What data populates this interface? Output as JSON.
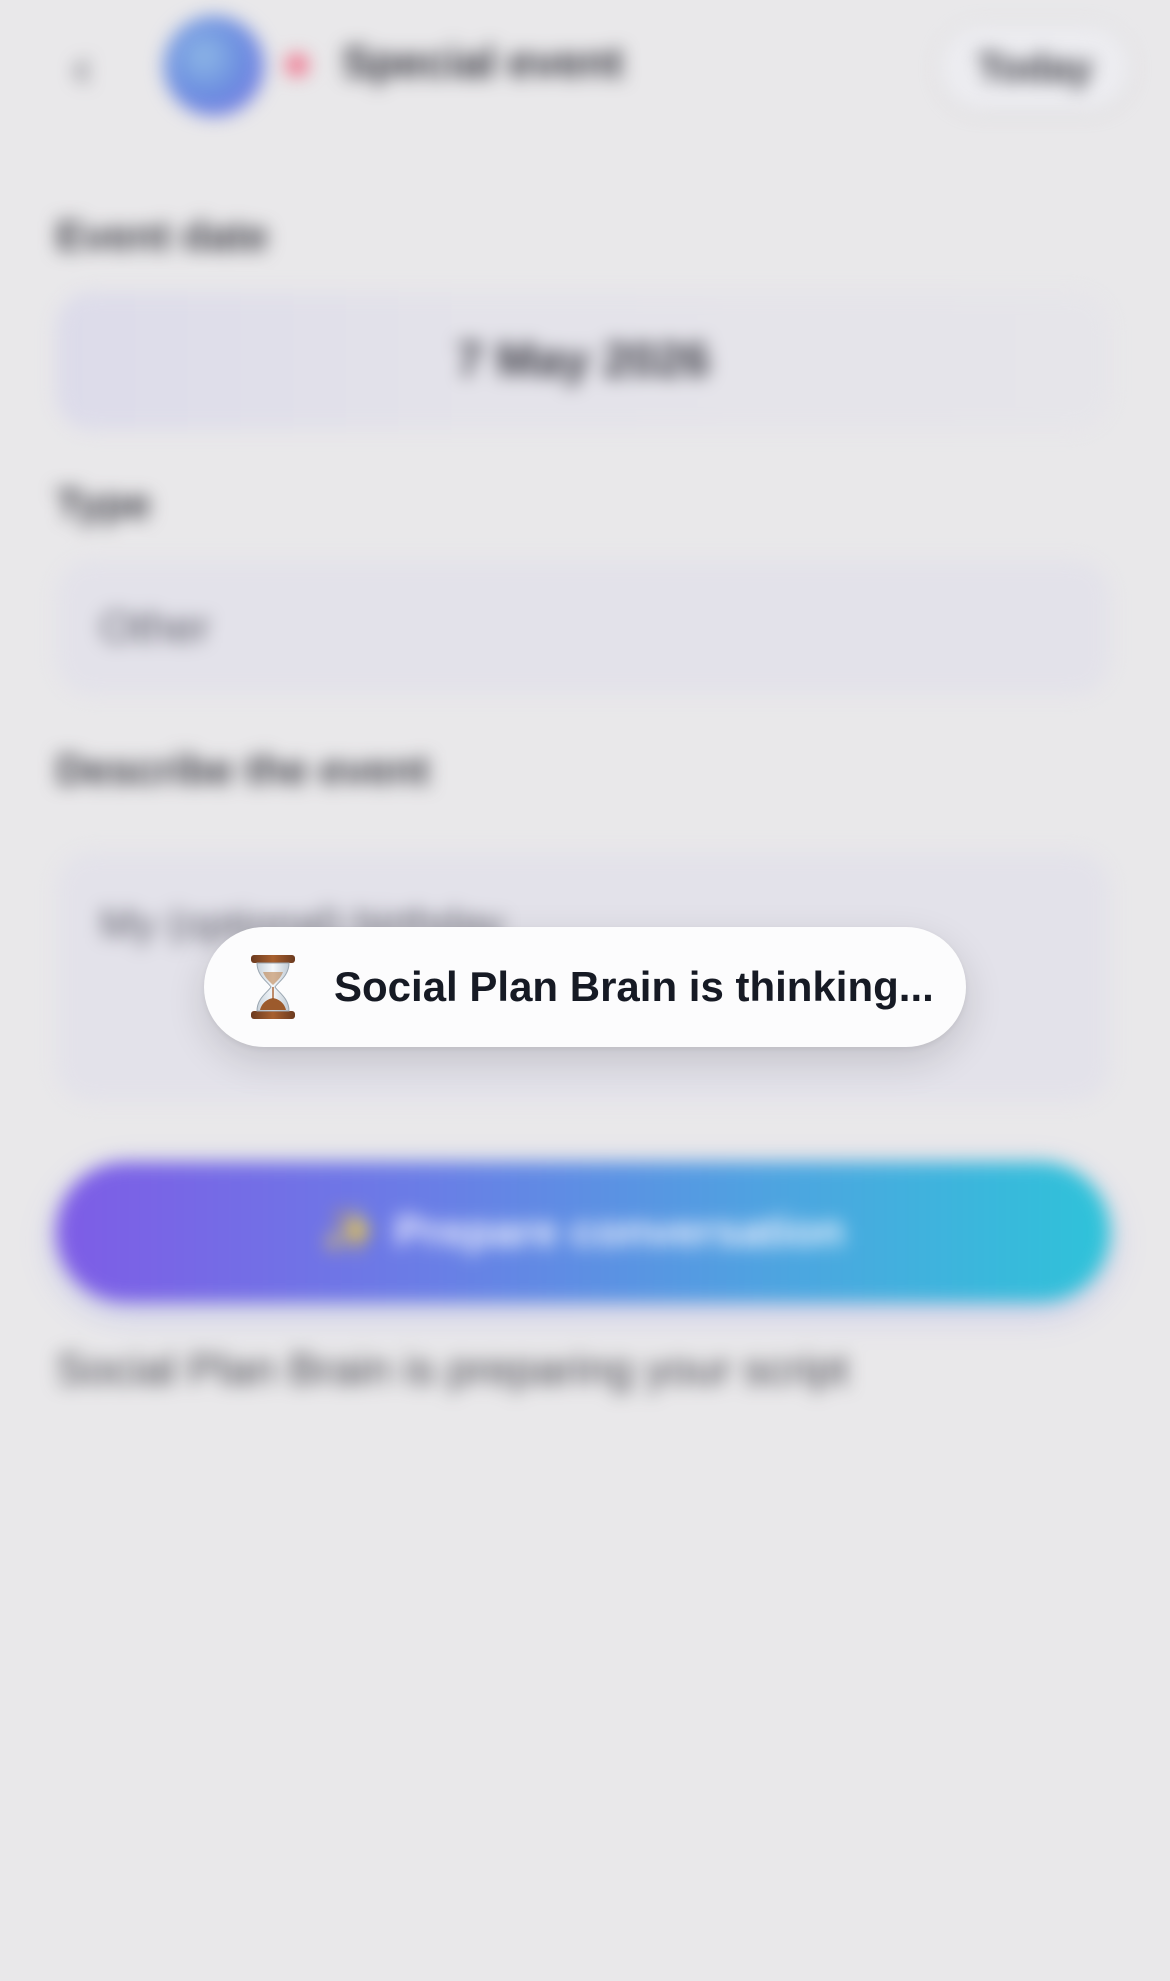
{
  "header": {
    "title": "Special event",
    "action_label": "Today"
  },
  "form": {
    "date_label": "Event date",
    "date_value": "7 May 2026",
    "type_label": "Type",
    "type_value": "Other",
    "description_label": "Describe the event",
    "description_placeholder": "My (optional) birthday"
  },
  "prepare_button": {
    "emoji": "✨",
    "label": "Prepare conversation"
  },
  "footer_note": "Social Plan Brain is preparing your script",
  "toast": {
    "icon": "hourglass-icon",
    "message": "Social Plan Brain is thinking..."
  },
  "colors": {
    "background": "#e9e8ea",
    "button_gradient_start": "#7e5ce6",
    "button_gradient_end": "#2ec3d9",
    "toast_background": "#fcfcfd",
    "toast_text": "#161a24"
  }
}
